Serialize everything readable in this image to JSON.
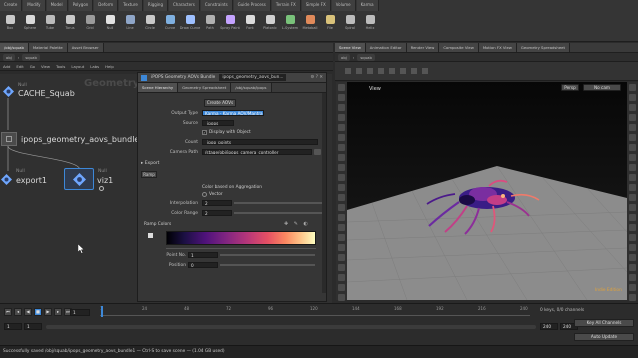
{
  "shelf": {
    "tabs": [
      "Create",
      "Modify",
      "Model",
      "Polygon",
      "Deform",
      "Texture",
      "Rigging",
      "Characters",
      "Constraints",
      "Guide Process",
      "Terrain FX",
      "Simple FX",
      "Volume",
      "Karma"
    ],
    "tools": [
      "Box",
      "Sphere",
      "Tube",
      "Torus",
      "Grid",
      "Null",
      "Line",
      "Circle",
      "Curve",
      "Draw Curve",
      "Path",
      "Spray Paint",
      "Font",
      "Platonic",
      "L-System",
      "Metaball",
      "File",
      "Spiral",
      "Helix"
    ]
  },
  "left_pane": {
    "tabs": [
      "/obj/squab",
      "Material Palette",
      "Asset Browser"
    ],
    "path": [
      "obj",
      "squab"
    ],
    "menus": [
      "Add",
      "Edit",
      "Go",
      "View",
      "Tools",
      "Layout",
      "Labs",
      "Help"
    ],
    "watermark": "Geometry"
  },
  "nodes": {
    "cache": {
      "type": "Null",
      "name": "CACHE_Squab"
    },
    "bundle": {
      "name": "ipops_geometry_aovs_bundle1"
    },
    "export": {
      "type": "Null",
      "name": "export1"
    },
    "viz": {
      "type": "Null",
      "name": "viz1"
    }
  },
  "params": {
    "header_type": "iPOPS Geometry AOVs Bundle",
    "header_name": "ipops_geometry_aovs_bun...",
    "tabs": [
      "Scene Hierarchy",
      "Geometry Spreadsheet",
      "/obj/squab/ipops"
    ],
    "button_top": "Create AOVs",
    "output_type_label": "Output Type",
    "output_type_value": "Karma - Karma AOV/Mantra",
    "source_label": "Source",
    "source_value": "_ipops",
    "checkbox_label": "Display with Object",
    "sourcecount_label": "Count",
    "sourcecount_value": "_ipop_points",
    "camera_label": "Camera Path",
    "camera_value": "/stage/obj/ipops_camera_controller",
    "section_export": "Export",
    "section_sub": "Ramp",
    "radio_label": "Color based on Aggregation",
    "radio_item": "Vector",
    "interpolation_label": "Interpolation",
    "interpolation_value": "2",
    "color_range_label": "Color Range",
    "color_range_value": "2",
    "ramp_title": "Ramp Colors",
    "point_no_label": "Point No.",
    "point_no_value": "1",
    "position_label": "Position",
    "position_value": "0"
  },
  "right_pane": {
    "tabs": [
      "Scene View",
      "Animation Editor",
      "Render View",
      "Composite View",
      "Motion FX View",
      "Geometry Spreadsheet"
    ],
    "path": [
      "obj",
      "squab"
    ],
    "viewport_label": "View",
    "persp_label": "Persp",
    "cam_label": "No cam",
    "watermark": "Indie Edition"
  },
  "timeline": {
    "frame_start": "1",
    "frame_current": "1",
    "frame_end": "240",
    "ticks": [
      "1",
      "24",
      "48",
      "72",
      "96",
      "120",
      "144",
      "168",
      "192",
      "216",
      "240"
    ],
    "auto_update": "Auto Update",
    "keys_label": "0 keys, 0/0 channels",
    "key_all": "Key All Channels"
  },
  "status": "Successfully saved /obj/squab/ipops_geometry_aovs_bundle1 — Ctrl-S to save scene — (1.04 GB used)",
  "colors": {
    "accent_blue": "#3d88d8",
    "node_blue": "#6fa7ff",
    "ramp_start": "#000004",
    "ramp_end": "#fcfdbf",
    "grid": "#9a9a9a"
  }
}
